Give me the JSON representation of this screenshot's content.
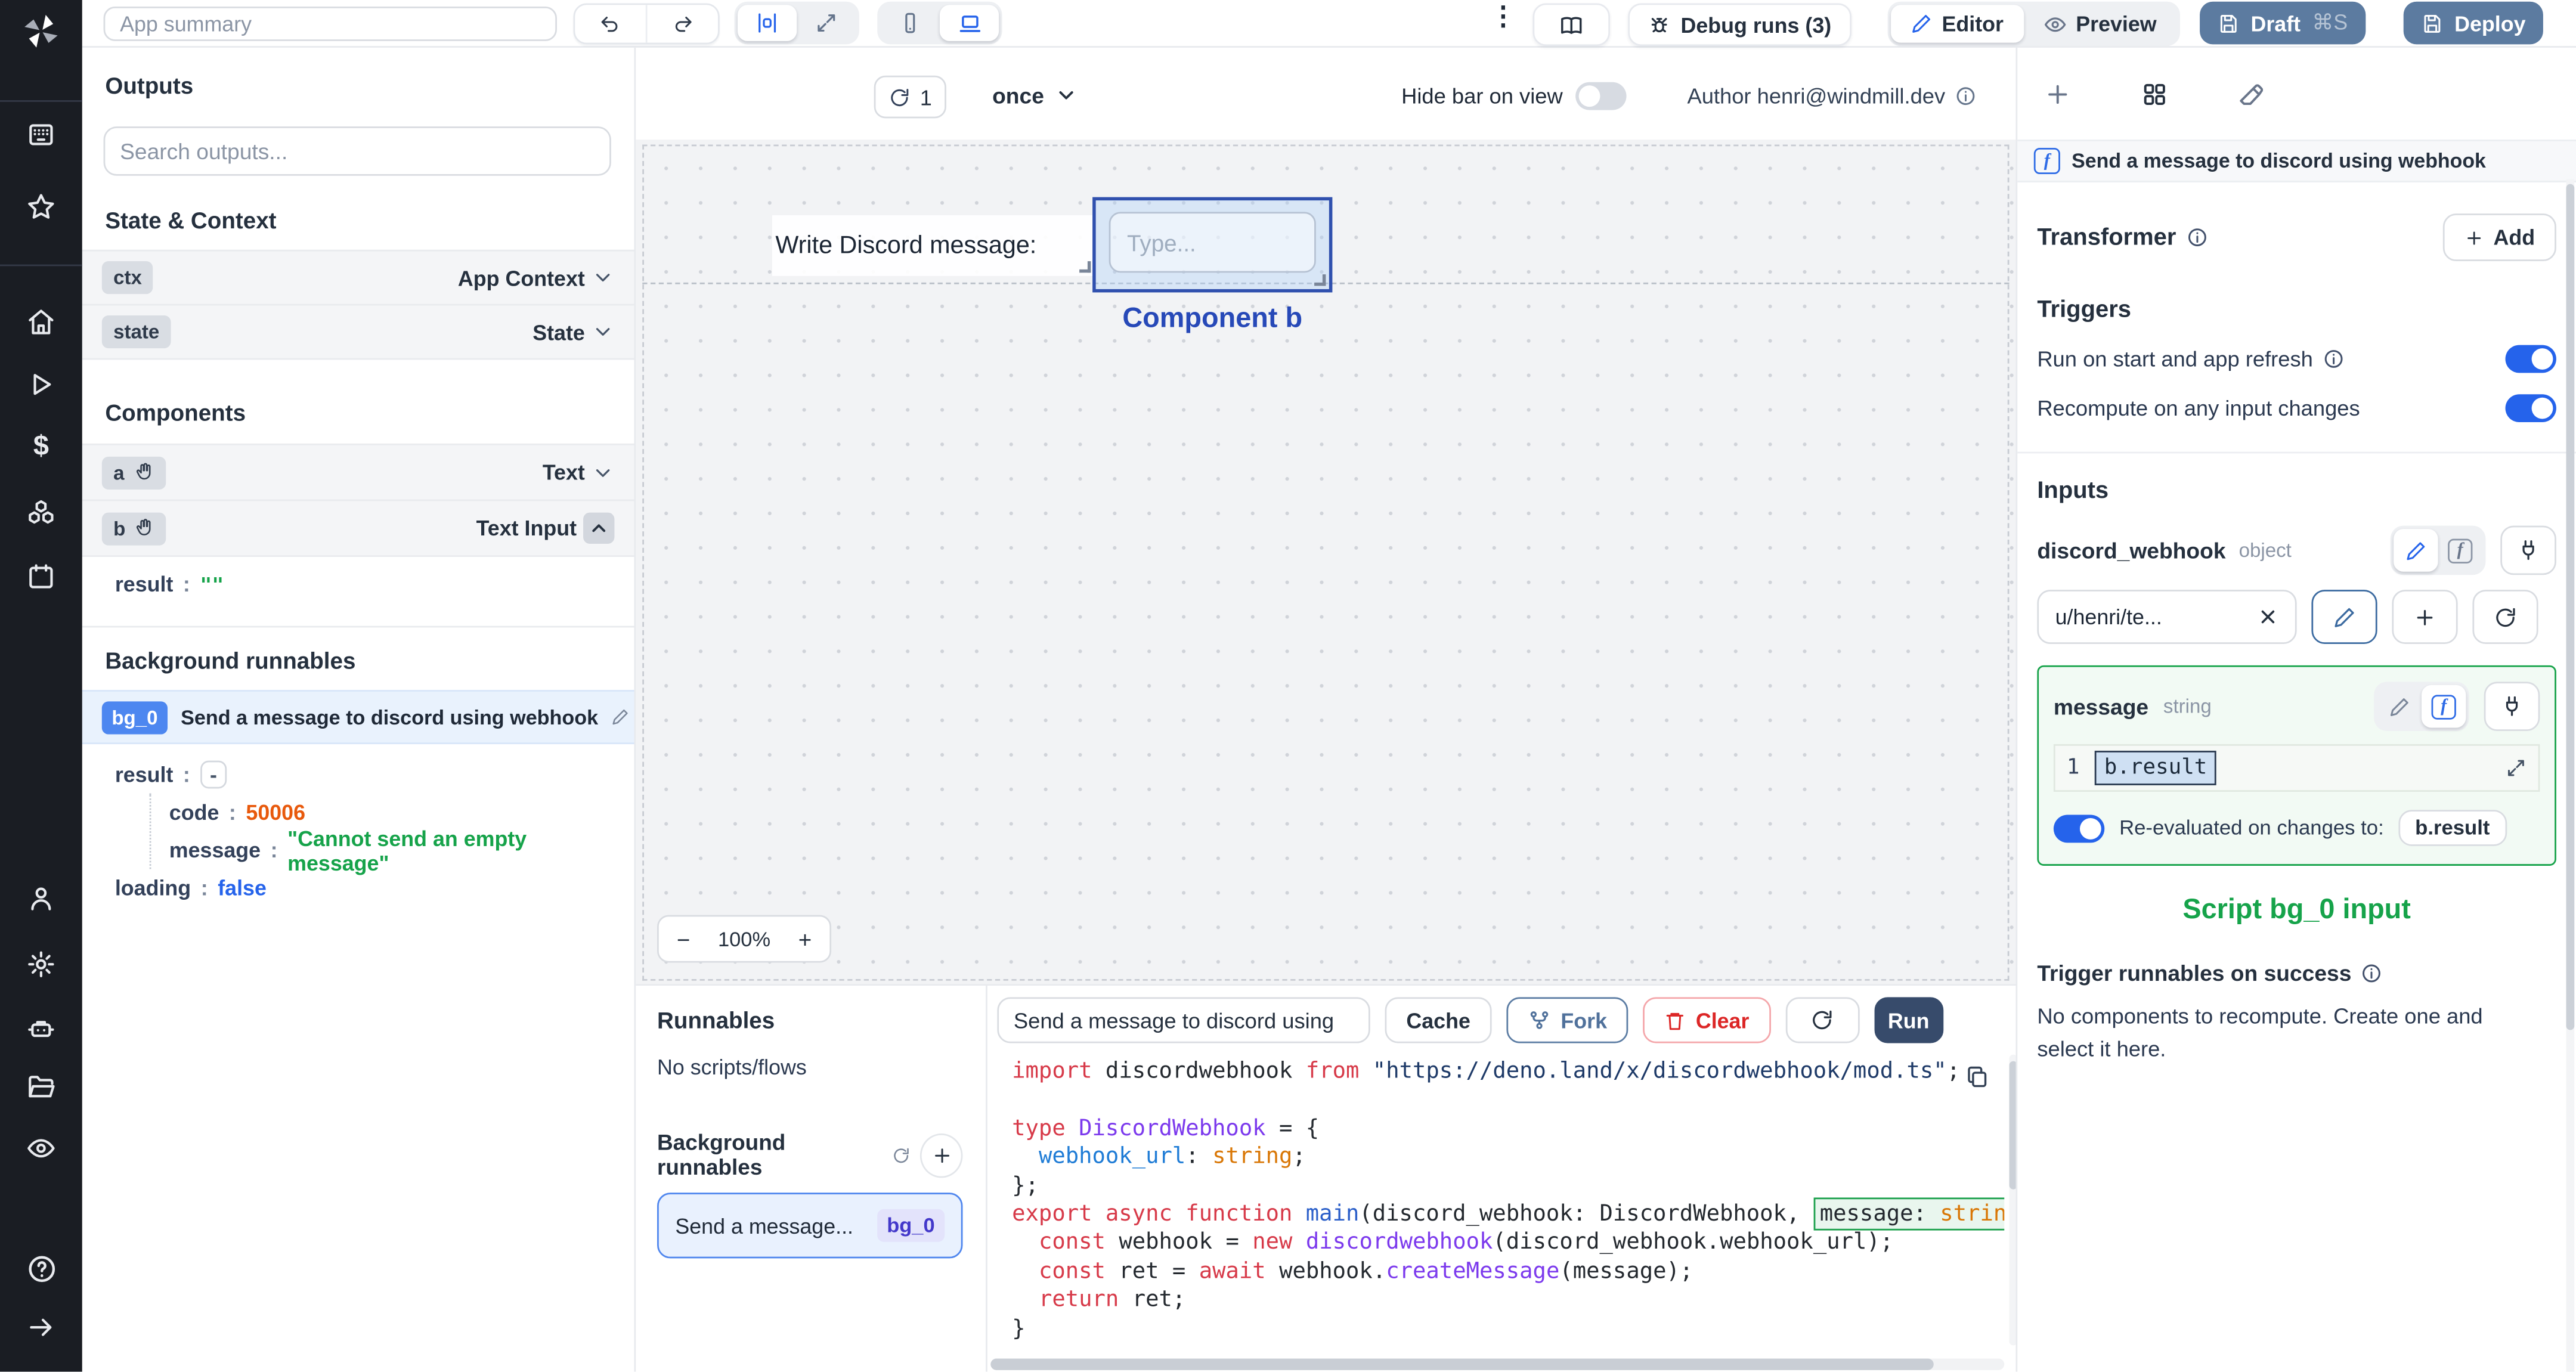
{
  "topbar": {
    "app_summary_placeholder": "App summary",
    "debug_runs_label": "Debug runs (3)",
    "editor_label": "Editor",
    "preview_label": "Preview",
    "draft_label": "Draft",
    "draft_shortcut": "⌘S",
    "deploy_label": "Deploy"
  },
  "canvas_bar": {
    "refresh_count": "1",
    "frequency": "once",
    "hide_bar_label": "Hide bar on view",
    "author_label": "Author henri@windmill.dev"
  },
  "left_panel": {
    "outputs_title": "Outputs",
    "search_placeholder": "Search outputs...",
    "state_context_title": "State & Context",
    "ctx_key": "ctx",
    "ctx_type": "App Context",
    "state_key": "state",
    "state_type": "State",
    "components_title": "Components",
    "comp_a_key": "a",
    "comp_a_type": "Text",
    "comp_b_key": "b",
    "comp_b_type": "Text Input",
    "result_key": "result",
    "result_value": "\"\"",
    "bg_title": "Background runnables",
    "bg0_badge": "bg_0",
    "bg0_title": "Send a message to discord using webhook",
    "out_result_key": "result",
    "out_result_value": "-",
    "out_code_key": "code",
    "out_code_value": "50006",
    "out_message_key": "message",
    "out_message_value": "\"Cannot send an empty message\"",
    "out_loading_key": "loading",
    "out_loading_value": "false"
  },
  "canvas": {
    "text_component": "Write Discord message:",
    "input_placeholder": "Type...",
    "selected_label": "Component b",
    "zoom_out": "−",
    "zoom_level": "100%",
    "zoom_in": "+"
  },
  "runnables": {
    "title": "Runnables",
    "empty_label": "No scripts/flows",
    "bg_title": "Background runnables",
    "item_label": "Send a message...",
    "item_badge": "bg_0"
  },
  "script_panel": {
    "name_value": "Send a message to discord using",
    "cache_label": "Cache",
    "fork_label": "Fork",
    "clear_label": "Clear",
    "run_label": "Run",
    "code_lines": [
      [
        {
          "c": "k",
          "s": "import "
        },
        {
          "c": "d",
          "s": "discordwebhook "
        },
        {
          "c": "k",
          "s": "from "
        },
        {
          "c": "s",
          "s": "\"https://deno.land/x/discordwebhook/mod.ts\""
        },
        {
          "c": "d",
          "s": ";"
        }
      ],
      [],
      [
        {
          "c": "k",
          "s": "type "
        },
        {
          "c": "t",
          "s": "DiscordWebhook "
        },
        {
          "c": "d",
          "s": "= {"
        }
      ],
      [
        {
          "c": "d",
          "s": "  "
        },
        {
          "c": "p",
          "s": "webhook_url"
        },
        {
          "c": "d",
          "s": ": "
        },
        {
          "c": "o",
          "s": "string"
        },
        {
          "c": "d",
          "s": ";"
        }
      ],
      [
        {
          "c": "d",
          "s": "};"
        }
      ],
      [
        {
          "c": "k",
          "s": "export async function "
        },
        {
          "c": "f",
          "s": "main"
        },
        {
          "c": "d",
          "s": "(discord_webhook: DiscordWebhook, "
        },
        {
          "c": "d",
          "s": "message: ",
          "b": 1
        },
        {
          "c": "o",
          "s": "string",
          "b": 1
        },
        {
          "c": "d",
          "s": ") {"
        }
      ],
      [
        {
          "c": "d",
          "s": "  "
        },
        {
          "c": "k",
          "s": "const"
        },
        {
          "c": "d",
          "s": " webhook = "
        },
        {
          "c": "k",
          "s": "new"
        },
        {
          "c": "d",
          "s": " "
        },
        {
          "c": "t",
          "s": "discordwebhook"
        },
        {
          "c": "d",
          "s": "(discord_webhook.webhook_url);"
        }
      ],
      [
        {
          "c": "d",
          "s": "  "
        },
        {
          "c": "k",
          "s": "const"
        },
        {
          "c": "d",
          "s": " ret = "
        },
        {
          "c": "k",
          "s": "await"
        },
        {
          "c": "d",
          "s": " webhook."
        },
        {
          "c": "t",
          "s": "createMessage"
        },
        {
          "c": "d",
          "s": "(message);"
        }
      ],
      [
        {
          "c": "d",
          "s": "  "
        },
        {
          "c": "k",
          "s": "return"
        },
        {
          "c": "d",
          "s": " ret;"
        }
      ],
      [
        {
          "c": "d",
          "s": "}"
        }
      ]
    ]
  },
  "right_panel": {
    "header_title": "Send a message to discord using webhook",
    "transformer_label": "Transformer",
    "add_label": "Add",
    "triggers_title": "Triggers",
    "trigger_run_on_start": "Run on start and app refresh",
    "trigger_recompute": "Recompute on any input changes",
    "inputs_title": "Inputs",
    "dw_name": "discord_webhook",
    "dw_type": "object",
    "dw_value": "u/henri/te...",
    "msg_name": "message",
    "msg_type": "string",
    "msg_line_number": "1",
    "msg_value": "b.result",
    "reeval_label": "Re-evaluated on changes to:",
    "reeval_target": "b.result",
    "script_input_label": "Script bg_0 input",
    "trigger_success_title": "Trigger runnables on success",
    "no_components_text": "No components to recompute. Create one and select it here."
  },
  "colors": {
    "accent_blue": "#2563eb",
    "slate_button": "#5c7ba0",
    "run_button": "#374b6b",
    "green": "#16a34a",
    "error_orange": "#e8590c",
    "rail_bg": "#1a1d23"
  }
}
